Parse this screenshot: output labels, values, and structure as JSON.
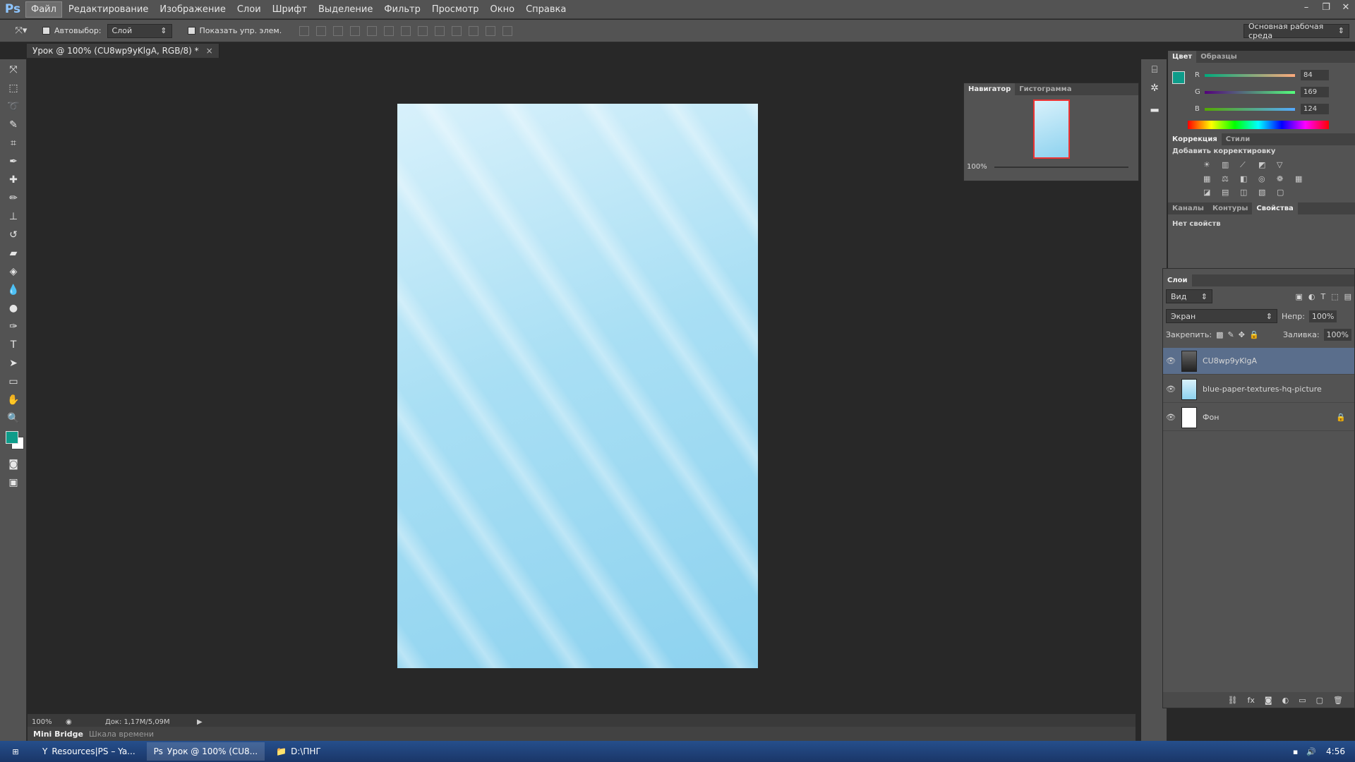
{
  "app": {
    "logo": "Ps"
  },
  "menu": [
    "Файл",
    "Редактирование",
    "Изображение",
    "Слои",
    "Шрифт",
    "Выделение",
    "Фильтр",
    "Просмотр",
    "Окно",
    "Справка"
  ],
  "window_controls": [
    "–",
    "❐",
    "✕"
  ],
  "options": {
    "autoselect_label": "Автовыбор:",
    "autoselect_value": "Слой",
    "show_controls_label": "Показать упр. элем.",
    "workspace": "Основная рабочая среда"
  },
  "document": {
    "tab_title": "Урок @ 100% (CU8wp9yKlgA, RGB/8) *",
    "close": "×"
  },
  "status": {
    "zoom": "100%",
    "doc_info": "Док: 1,17M/5,09M"
  },
  "bottom_tabs": [
    "Mini Bridge",
    "Шкала времени"
  ],
  "navigator": {
    "tabs": [
      "Навигатор",
      "Гистограмма"
    ],
    "zoom": "100%"
  },
  "color_panel": {
    "tabs": [
      "Цвет",
      "Образцы"
    ],
    "r_label": "R",
    "g_label": "G",
    "b_label": "B",
    "r": "84",
    "g": "169",
    "b": "124",
    "foreground": "#0e9c8a",
    "background": "#ffffff"
  },
  "adjust_panel": {
    "tabs": [
      "Коррекция",
      "Стили"
    ],
    "heading": "Добавить корректировку"
  },
  "props_panel": {
    "tabs": [
      "Каналы",
      "Контуры",
      "Свойства"
    ],
    "text": "Нет свойств"
  },
  "layers_panel": {
    "title": "Слои",
    "kind": "Вид",
    "blend_mode": "Экран",
    "opacity_label": "Непр:",
    "opacity": "100%",
    "lock_label": "Закрепить:",
    "fill_label": "Заливка:",
    "fill": "100%",
    "layers": [
      {
        "name": "CU8wp9yKlgA"
      },
      {
        "name": "blue-paper-textures-hq-picture"
      },
      {
        "name": "Фон"
      }
    ]
  },
  "taskbar": {
    "items": [
      "Resources|PS – Ya...",
      "Урок @ 100% (CU8...",
      "D:\\ПНГ"
    ],
    "clock": "4:56"
  }
}
